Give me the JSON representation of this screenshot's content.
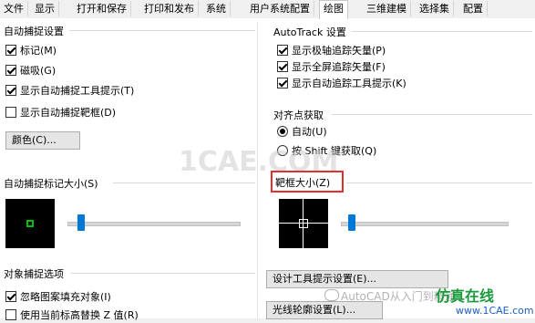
{
  "tabs": [
    "文件",
    "显示",
    "打开和保存",
    "打印和发布",
    "系统",
    "用户系统配置",
    "绘图",
    "三维建模",
    "选择集",
    "配置"
  ],
  "active_tab": "绘图",
  "autosnap": {
    "title": "自动捕捉设置",
    "options": [
      {
        "label": "标记(M)",
        "checked": true
      },
      {
        "label": "磁吸(G)",
        "checked": true
      },
      {
        "label": "显示自动捕捉工具提示(T)",
        "checked": true
      },
      {
        "label": "显示自动捕捉靶框(D)",
        "checked": false
      }
    ],
    "color_button": "颜色(C)..."
  },
  "autotrack": {
    "title": "AutoTrack 设置",
    "options": [
      {
        "label": "显示极轴追踪矢量(P)",
        "checked": true
      },
      {
        "label": "显示全屏追踪矢量(F)",
        "checked": true
      },
      {
        "label": "显示自动追踪工具提示(K)",
        "checked": true
      }
    ]
  },
  "alignment": {
    "title": "对齐点获取",
    "options": [
      {
        "label": "自动(U)",
        "checked": true
      },
      {
        "label": "按 Shift 键获取(Q)",
        "checked": false
      }
    ]
  },
  "marker_size": {
    "title": "自动捕捉标记大小(S)",
    "slider_level": 0.08
  },
  "aperture_size": {
    "title": "靶框大小(Z)",
    "slider_level": 0.08
  },
  "object_snap": {
    "title": "对象捕捉选项",
    "options": [
      {
        "label": "忽略图案填充对象(I)",
        "checked": true
      },
      {
        "label": "使用当前标高替换 Z 值(R)",
        "checked": false
      }
    ]
  },
  "buttons": {
    "tooltip_settings": "设计工具提示设置(E)...",
    "lightglyph_settings": "光线轮廓设置(L)..."
  },
  "watermarks": {
    "center": "1CAE.COM",
    "wechat": "AutoCAD从入门到精通",
    "brand": "仿真在线",
    "url": "www.1CAE.com"
  },
  "colors": {
    "highlight": "#e03030",
    "slider_thumb": "#0078d7",
    "marker_green": "#00c000"
  }
}
